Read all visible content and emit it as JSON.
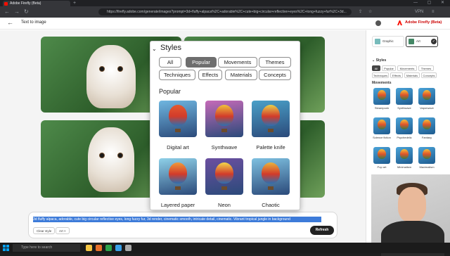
{
  "browser": {
    "tab_title": "Adobe Firefly (Beta)",
    "new_tab": "+",
    "url": "https://firefly.adobe.com/generate/images?prompt=3d+fluffy+alpaca%2C+adorable%2C+cute+big+circular+reflective+eyes%2C+long+fuzzy+fur%2C+3d...",
    "vpn_label": "VPN"
  },
  "header": {
    "back": "←",
    "title": "Text to image",
    "brand": "Adobe Firefly (Beta)"
  },
  "prompt": {
    "text": "3d fluffy alpaca, adorable, cute big circular reflective eyes, long fuzzy fur, 3d render, cinematic smooth, intricate detail, cinematic. Vibrant tropical jungle in background",
    "clear_style": "Clear style",
    "chip_label": "Art",
    "chip_close": "×",
    "refresh": "Refresh"
  },
  "popup": {
    "title": "Styles",
    "chevron": "⌄",
    "tabs": [
      "All",
      "Popular",
      "Movements",
      "Themes",
      "Techniques",
      "Effects",
      "Materials",
      "Concepts"
    ],
    "selected_tab": "Popular",
    "section": "Popular",
    "items": [
      {
        "label": "Digital art",
        "bg": "#6fb6e0",
        "balloon": "#e45a2f"
      },
      {
        "label": "Synthwave",
        "bg": "#c56ab8",
        "balloon": "#f0c23a"
      },
      {
        "label": "Palette knife",
        "bg": "#4aa0c8",
        "balloon": "#e8d04a"
      },
      {
        "label": "Layered paper",
        "bg": "#8ed0e8",
        "balloon": "#f09a3a"
      },
      {
        "label": "Neon",
        "bg": "#6b4fa0",
        "balloon": "#f3d84a"
      },
      {
        "label": "Chaotic",
        "bg": "#7ec0e0",
        "balloon": "#e9b23c"
      }
    ]
  },
  "sidebar": {
    "content_types": [
      {
        "label": "Graphic",
        "selected": false
      },
      {
        "label": "Art",
        "selected": true
      }
    ],
    "styles_title": "Styles",
    "style_tabs": [
      "All",
      "Popular",
      "Movements",
      "Themes",
      "Techniques",
      "Effects",
      "Materials",
      "Concepts"
    ],
    "movements_title": "Movements",
    "thumbs": [
      "Steampunk",
      "Synthwave",
      "Vaporwave",
      "Science fiction",
      "Psychedelic",
      "Fantasy",
      "Pop art",
      "Minimalism",
      "Maximalism"
    ]
  },
  "taskbar": {
    "search": "Type here to search"
  },
  "colors": {
    "adobe_red": "#fa0f00",
    "selection": "#3d7bd9"
  }
}
